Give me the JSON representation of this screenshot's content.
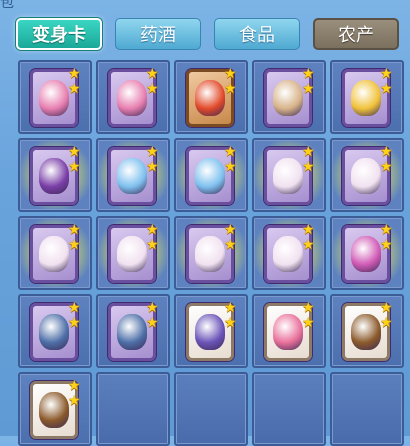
{
  "header": {
    "title_fragment": "包"
  },
  "tabs": [
    {
      "label": "变身卡",
      "state": "active"
    },
    {
      "label": "药酒",
      "state": "normal"
    },
    {
      "label": "食品",
      "state": "normal"
    },
    {
      "label": "农产",
      "state": "tinted"
    }
  ],
  "items": [
    {
      "kind": "transformation-card",
      "creature": "pink-flower-creature",
      "stars": 2,
      "frame": "purple",
      "color": "#e77fb0",
      "glow": false
    },
    {
      "kind": "transformation-card",
      "creature": "pink-flower-creature",
      "stars": 2,
      "frame": "purple",
      "color": "#e77fb0",
      "glow": false
    },
    {
      "kind": "transformation-card",
      "creature": "fire-beast",
      "stars": 2,
      "frame": "red",
      "color": "#e24a2a",
      "glow": false
    },
    {
      "kind": "transformation-card",
      "creature": "pig-creature",
      "stars": 2,
      "frame": "purple",
      "color": "#d7b38a",
      "glow": false
    },
    {
      "kind": "transformation-card",
      "creature": "yellow-dragon",
      "stars": 2,
      "frame": "purple",
      "color": "#f0c23a",
      "glow": false
    },
    {
      "kind": "transformation-card",
      "creature": "witch",
      "stars": 2,
      "frame": "purple",
      "color": "#7a3fa8",
      "glow": true
    },
    {
      "kind": "transformation-card",
      "creature": "blue-fairy",
      "stars": 2,
      "frame": "purple",
      "color": "#7fc1ef",
      "glow": true
    },
    {
      "kind": "transformation-card",
      "creature": "blue-fairy",
      "stars": 2,
      "frame": "purple",
      "color": "#7fc1ef",
      "glow": true
    },
    {
      "kind": "transformation-card",
      "creature": "bat-girl",
      "stars": 2,
      "frame": "purple",
      "color": "#f1e1f0",
      "glow": true
    },
    {
      "kind": "transformation-card",
      "creature": "bat-girl",
      "stars": 2,
      "frame": "purple",
      "color": "#f1e1f0",
      "glow": true
    },
    {
      "kind": "transformation-card",
      "creature": "bat-girl",
      "stars": 2,
      "frame": "purple",
      "color": "#f1e1f0",
      "glow": true
    },
    {
      "kind": "transformation-card",
      "creature": "bat-girl",
      "stars": 2,
      "frame": "purple",
      "color": "#f1e1f0",
      "glow": true
    },
    {
      "kind": "transformation-card",
      "creature": "bat-girl",
      "stars": 2,
      "frame": "purple",
      "color": "#f1e1f0",
      "glow": true
    },
    {
      "kind": "transformation-card",
      "creature": "bat-girl",
      "stars": 2,
      "frame": "purple",
      "color": "#f1e1f0",
      "glow": true
    },
    {
      "kind": "transformation-card",
      "creature": "pink-witch",
      "stars": 2,
      "frame": "purple",
      "color": "#d05ab5",
      "glow": true
    },
    {
      "kind": "transformation-card",
      "creature": "armored-knight",
      "stars": 2,
      "frame": "purple",
      "color": "#4e6fa8",
      "glow": false
    },
    {
      "kind": "transformation-card",
      "creature": "armored-knight",
      "stars": 2,
      "frame": "purple",
      "color": "#4e6fa8",
      "glow": false
    },
    {
      "kind": "transformation-card",
      "creature": "purple-warrior",
      "stars": 2,
      "frame": "white",
      "color": "#6b54b8",
      "glow": false
    },
    {
      "kind": "transformation-card",
      "creature": "pink-girl",
      "stars": 2,
      "frame": "white",
      "color": "#e9709a",
      "glow": false
    },
    {
      "kind": "transformation-card",
      "creature": "brown-bear",
      "stars": 2,
      "frame": "white",
      "color": "#8b5a2b",
      "glow": false
    },
    {
      "kind": "transformation-card",
      "creature": "brown-bear",
      "stars": 2,
      "frame": "white",
      "color": "#8b5a2b",
      "glow": false
    },
    {
      "kind": "empty"
    },
    {
      "kind": "empty"
    },
    {
      "kind": "empty"
    },
    {
      "kind": "empty"
    }
  ],
  "star_glyph": "★"
}
